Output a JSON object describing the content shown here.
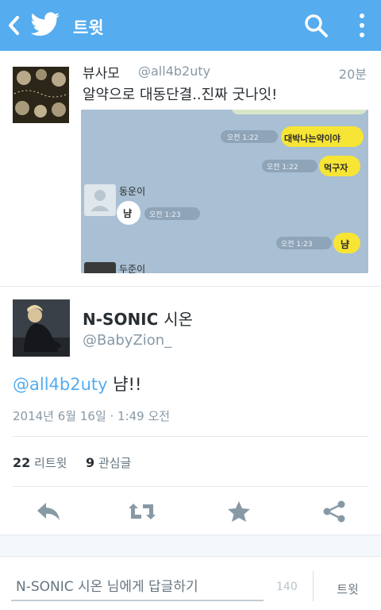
{
  "appbar": {
    "title": "트윗",
    "back_icon": "chevron-left-icon",
    "logo_icon": "twitter-bird-icon",
    "search_icon": "search-icon",
    "more_icon": "overflow-menu-icon",
    "color": "#55acee"
  },
  "quoted_tweet": {
    "name": "뷰사모",
    "handle": "@all4b2uty",
    "time": "20분",
    "text": "알약으로 대동단결..진짜 굿나잇!",
    "media": {
      "messages": [
        {
          "side": "right",
          "time": "오전 1:22",
          "text": "대박나는약이야"
        },
        {
          "side": "right",
          "time": "오전 1:22",
          "text": "먹구자"
        },
        {
          "side": "left",
          "sender": "동운이",
          "time": "오전 1:23",
          "text": "냠"
        },
        {
          "side": "right",
          "time": "오전 1:23",
          "text": "냠"
        },
        {
          "side": "left",
          "sender": "두준이"
        }
      ]
    }
  },
  "tweet": {
    "name_latin": "N-SONIC",
    "name_korean": "시온",
    "handle": "@BabyZion_",
    "mention": "@all4b2uty",
    "text_rest": " 냠!!",
    "date": "2014년 6월 16일 · 1:49 오전",
    "retweet_count": "22",
    "retweet_label": "리트윗",
    "favorite_count": "9",
    "favorite_label": "관심글"
  },
  "actions": {
    "reply_icon": "reply-icon",
    "retweet_icon": "retweet-icon",
    "favorite_icon": "star-icon",
    "share_icon": "share-icon"
  },
  "composer": {
    "placeholder": "N-SONIC 시온 님에게 답글하기",
    "counter": "140",
    "send_label": "트윗"
  }
}
